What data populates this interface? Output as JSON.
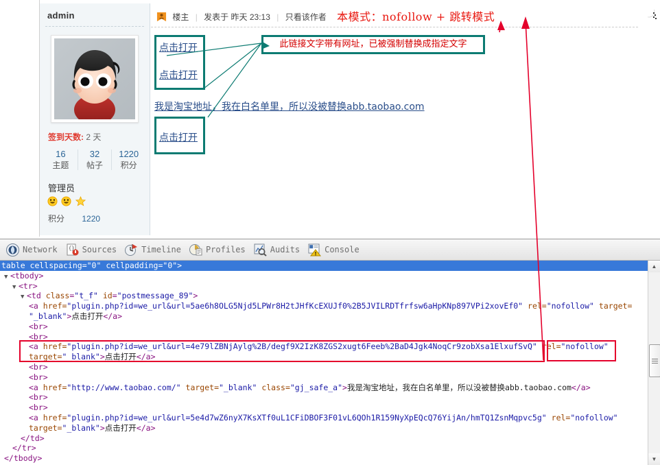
{
  "forum": {
    "user": {
      "name": "admin",
      "avatar_alt": "cartoon-avatar",
      "signin_label": "签到天数:",
      "signin_value": "2 天",
      "stats": [
        {
          "value": "16",
          "label": "主题"
        },
        {
          "value": "32",
          "label": "帖子"
        },
        {
          "value": "1220",
          "label": "积分"
        }
      ],
      "group": "管理员",
      "medals": [
        "smiley-medal",
        "smiley-medal",
        "star-medal"
      ],
      "credit_label": "积分",
      "credit_value": "1220"
    },
    "post": {
      "poster_badge": "楼主",
      "posted_prefix": "发表于",
      "posted_time": "昨天 23:13",
      "only_author": "只看该作者",
      "mode_note": "本模式：nofollow + 跳转模式",
      "links": [
        {
          "text": "点击打开"
        },
        {
          "text": "点击打开"
        },
        {
          "text": "点击打开"
        }
      ],
      "taobao_line": "我是淘宝地址，我在白名单里，所以没被替换abb.taobao.com",
      "callout": "此链接文字带有网址，已被强制替换成指定文字"
    }
  },
  "devtools": {
    "tabs": [
      {
        "label": "Network",
        "icon": "network-icon"
      },
      {
        "label": "Sources",
        "icon": "sources-icon"
      },
      {
        "label": "Timeline",
        "icon": "timeline-icon"
      },
      {
        "label": "Profiles",
        "icon": "profiles-icon"
      },
      {
        "label": "Audits",
        "icon": "audits-icon"
      },
      {
        "label": "Console",
        "icon": "console-icon"
      }
    ],
    "dom": {
      "l0": "table cellspacing=\"0\" cellpadding=\"0\">",
      "l1_tag": "<tbody>",
      "l2_tag": "<tr>",
      "l3_a": "<td",
      "l3_attr1": "class",
      "l3_v1": "\"t_f\"",
      "l3_attr2": "id",
      "l3_v2": "\"postmessage_89\"",
      "l3_close": ">",
      "a1_open": "<a",
      "a1_hrefattr": "href=",
      "a1_href": "\"plugin.php?id=we_url&url=5ae6h8OLG5Njd5LPWr8H2tJHfKcEXUJf0%2B5JVILRDTfrfsw6aHpKNp897VPi2xovEf0\"",
      "a1_rel": "rel=",
      "a1_relv": "\"nofollow\"",
      "a1_target": "target=",
      "a1_targetv": "\"_blank\"",
      "a1_text": "点击打开",
      "a1_end": "</a>",
      "br": "<br>",
      "a2_href": "\"plugin.php?id=we_url&url=4e79lZBNjAylg%2B/degf9X2IzK8ZGS2xugt6Feeb%2BaD4Jgk4NoqCr9zobXsa1ElxufSvQ\"",
      "a2_relv": "\"nofollow\"",
      "a2_text": "点击打开",
      "a3_href": "\"http://www.taobao.com/\"",
      "a3_target": "\"_blank\"",
      "a3_class": "class=",
      "a3_classv": "\"gj_safe_a\"",
      "a3_text": "我是淘宝地址，我在白名单里，所以没被替换abb.taobao.com",
      "a4_href": "\"plugin.php?id=we_url&url=5e4d7wZ6nyX7KsXTf0uL1CFiDBOF3F01vL6QOh1R159NyXpEQcQ76YijAn/hmTQ1ZsnMqpvc5g\"",
      "a4_relv": "\"nofollow\"",
      "a4_text": "点击打开",
      "td_close": "</td>",
      "tr_close": "</tr>",
      "tbody_close": "</tbody>"
    }
  }
}
